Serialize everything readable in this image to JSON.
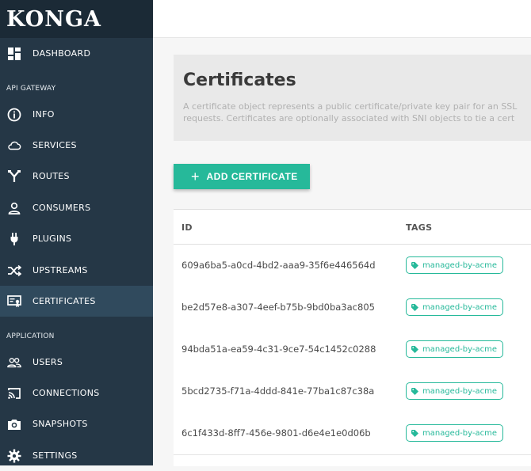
{
  "app": {
    "logo": "KONGA"
  },
  "sidebar": {
    "top_items": [
      {
        "label": "DASHBOARD",
        "icon": "dashboard-icon"
      }
    ],
    "sections": [
      {
        "label": "API GATEWAY",
        "items": [
          {
            "label": "INFO",
            "icon": "info-icon"
          },
          {
            "label": "SERVICES",
            "icon": "cloud-icon"
          },
          {
            "label": "ROUTES",
            "icon": "routes-icon"
          },
          {
            "label": "CONSUMERS",
            "icon": "user-icon"
          },
          {
            "label": "PLUGINS",
            "icon": "plug-icon"
          },
          {
            "label": "UPSTREAMS",
            "icon": "shuffle-icon"
          },
          {
            "label": "CERTIFICATES",
            "icon": "certificate-icon",
            "active": true
          }
        ]
      },
      {
        "label": "APPLICATION",
        "items": [
          {
            "label": "USERS",
            "icon": "users-icon"
          },
          {
            "label": "CONNECTIONS",
            "icon": "cast-icon"
          },
          {
            "label": "SNAPSHOTS",
            "icon": "camera-icon"
          },
          {
            "label": "SETTINGS",
            "icon": "gear-icon"
          }
        ]
      }
    ]
  },
  "main": {
    "title": "Certificates",
    "description_line1": "A certificate object represents a public certificate/private key pair for an SSL",
    "description_line2": "requests. Certificates are optionally associated with SNI objects to tie a cert",
    "add_button_label": "ADD CERTIFICATE",
    "table": {
      "columns": [
        "ID",
        "TAGS"
      ],
      "rows": [
        {
          "id": "609a6ba5-a0cd-4bd2-aaa9-35f6e446564d",
          "tag": "managed-by-acme"
        },
        {
          "id": "be2d57e8-a307-4eef-b75b-9bd0ba3ac805",
          "tag": "managed-by-acme"
        },
        {
          "id": "94bda51a-ea59-4c31-9ce7-54c1452c0288",
          "tag": "managed-by-acme"
        },
        {
          "id": "5bcd2735-f71a-4ddd-841e-77ba1c87c38a",
          "tag": "managed-by-acme"
        },
        {
          "id": "6c1f433d-8ff7-456e-9801-d6e4e1e0d06b",
          "tag": "managed-by-acme"
        }
      ]
    }
  },
  "colors": {
    "sidebar_bg": "#253746",
    "accent": "#26b99a",
    "active_item_bg": "#304a5d"
  }
}
